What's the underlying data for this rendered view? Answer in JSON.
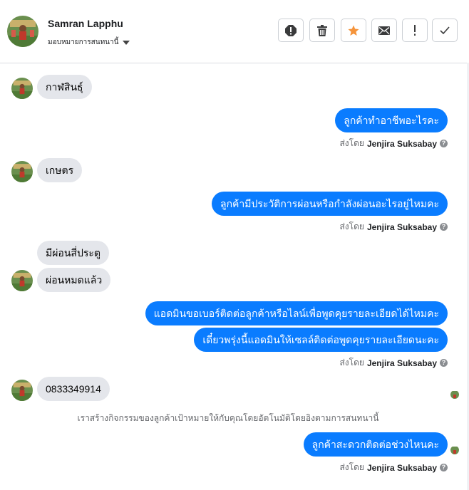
{
  "header": {
    "name": "Samran Lapphu",
    "assign_label": "มอบหมายการสนทนานี้",
    "buttons": [
      {
        "name": "spam-icon"
      },
      {
        "name": "trash-icon"
      },
      {
        "name": "star-icon"
      },
      {
        "name": "mail-icon"
      },
      {
        "name": "exclamation-icon"
      },
      {
        "name": "check-icon"
      }
    ]
  },
  "messages": {
    "in1": "กาฬสินธุ์",
    "out1": "ลูกค้าทำอาชีพอะไรคะ",
    "in2": "เกษตร",
    "out2": "ลูกค้ามีประวัติการผ่อนหรือกำลังผ่อนอะไรอยู่ไหมคะ",
    "in3a": "มีผ่อนสี่ประตู",
    "in3b": "ผ่อนหมดแล้ว",
    "out3a": "แอดมินขอเบอร์ติดต่อลูกค้าหรือไลน์เพื่อพูดคุยรายละเอียดได้ไหมคะ",
    "out3b": "เดี๋ยวพรุ่งนี้แอดมินให้เซลล์ติดต่อพูดคุยรายละเอียดนะคะ",
    "in4": "0833349914",
    "out4": "ลูกค้าสะดวกติดต่อช่วงไหนคะ"
  },
  "sent_by": {
    "prefix": "ส่งโดย",
    "agent": "Jenjira Suksabay",
    "help": "?"
  },
  "notice": "เราสร้างกิจกรรมของลูกค้าเป้าหมายให้กับคุณโดยอัตโนมัติโดยอิงตามการสนทนานี้",
  "colors": {
    "outgoing": "#0a7cff",
    "incoming": "#e4e6eb",
    "star": "#f5943b"
  }
}
